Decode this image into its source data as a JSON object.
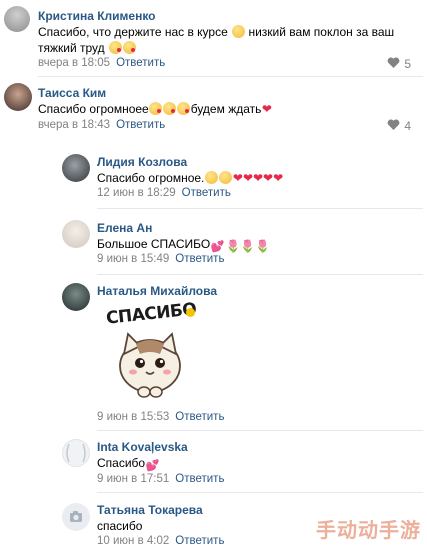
{
  "comments": [
    {
      "author": "Кристина Клименко",
      "text": "Спасибо, что держите нас в курсе",
      "text_after": " низкий вам поклон за ваш тяжкий труд",
      "time": "вчера в 18:05",
      "reply": "Ответить",
      "likes": "5"
    },
    {
      "author": "Таисса Ким",
      "text": "Спасибо огромноее",
      "text_after": "будем ждать",
      "time": "вчера в 18:43",
      "reply": "Ответить",
      "likes": "4"
    }
  ],
  "replies": [
    {
      "author": "Лидия Козлова",
      "text": "Спасибо огромное.",
      "time": "12 июн в 18:29",
      "reply": "Ответить"
    },
    {
      "author": "Елена Ан",
      "text": "Большое СПАСИБО",
      "time": "9 июн в 15:49",
      "reply": "Ответить"
    },
    {
      "author": "Наталья Михайлова",
      "sticker_text": "СПАСИБО",
      "time": "9 июн в 15:53",
      "reply": "Ответить"
    },
    {
      "author": "Inta Kovaļevska",
      "text": "Спасибо",
      "time": "9 июн в 17:51",
      "reply": "Ответить"
    },
    {
      "author": "Татьяна Токарева",
      "text": "спасибо",
      "time": "10 июн в 4:02",
      "reply": "Ответить"
    }
  ],
  "watermark": "手动动手游",
  "colors": {
    "link": "#2a5885",
    "meta": "#828282",
    "heart": "#e8284a"
  }
}
